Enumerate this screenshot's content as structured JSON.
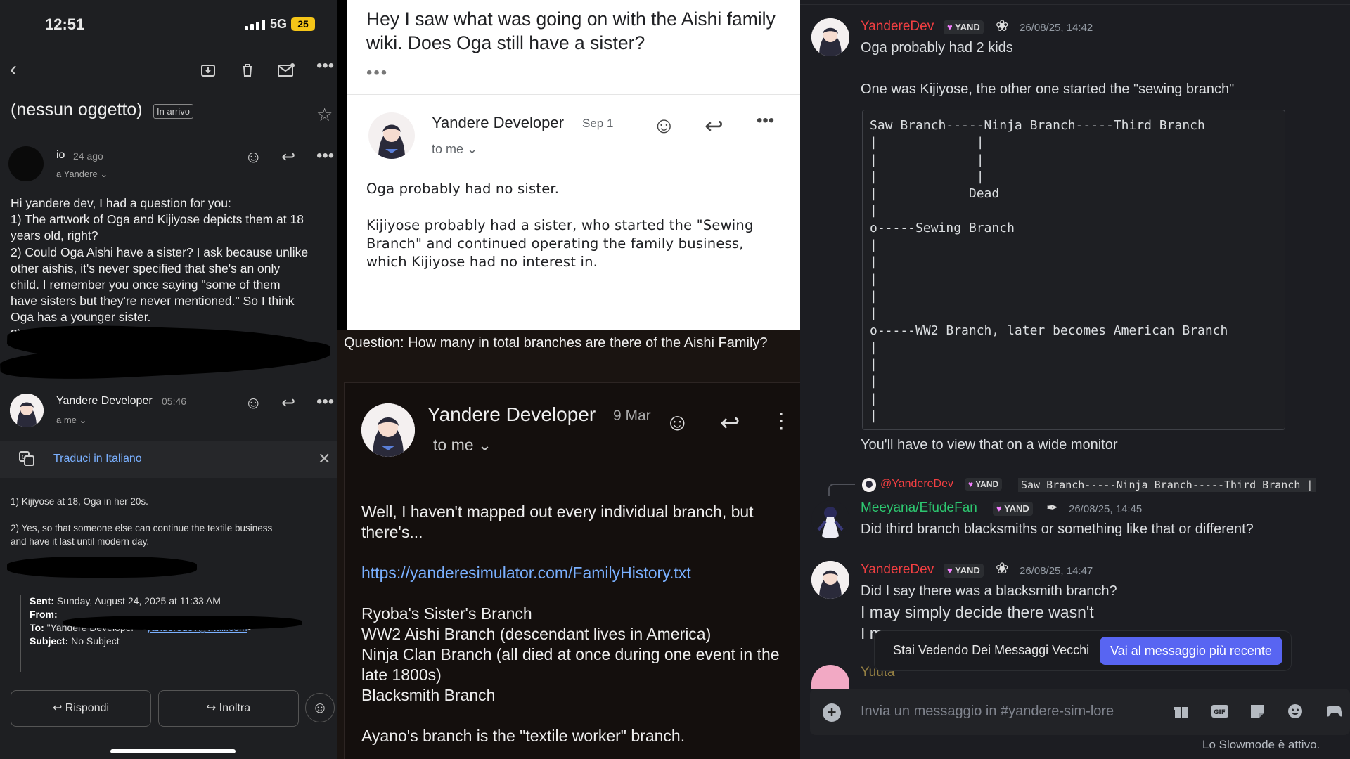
{
  "panel_a": {
    "status": {
      "time": "12:51",
      "network": "5G",
      "battery": "25"
    },
    "subject": "(nessun oggetto)",
    "folder_tag": "In arrivo",
    "msg1": {
      "from": "io",
      "date": "24 ago",
      "to": "a Yandere ⌄",
      "body": [
        "Hi yandere dev, I had a question for you:",
        "1) The artwork of Oga and Kijiyose depicts them at 18",
        "years old, right?",
        "2) Could Oga Aishi have a sister? I ask because unlike",
        "other aishis, it's never specified that she's an only",
        "child. I remember you once saying \"some of them",
        "have sisters but they're never mentioned.\" So I think",
        "Oga has a younger sister.",
        "3) C..."
      ]
    },
    "msg2": {
      "from": "Yandere Developer",
      "time": "05:46",
      "to": "a me ⌄"
    },
    "translate_label": "Traduci in Italiano",
    "reply_body": [
      "1) Kijiyose at 18, Oga in her 20s.",
      "",
      "2) Yes, so that someone else can continue the textile business",
      "and have it last until modern day."
    ],
    "quote": {
      "sent_label": "Sent:",
      "sent_value": "Sunday, August 24, 2025 at 11:33 AM",
      "from_label": "From:",
      "to_label": "To:",
      "to_value": "\"Yandere Developer\" <",
      "to_email": "yanderedev@mail.com",
      "to_end": ">",
      "subject_label": "Subject:",
      "subject_value": "No Subject"
    },
    "buttons": {
      "reply": "↩  Rispondi",
      "forward": "↪  Inoltra"
    }
  },
  "panel_b": {
    "question": "Hey I saw what was going on with the Aishi family wiki. Does Oga still have a sister?",
    "sender": "Yandere Developer",
    "date": "Sep 1",
    "to": "to me ⌄",
    "body": [
      "Oga probably had no sister.",
      "",
      "Kijiyose probably had a sister, who started the \"Sewing",
      "Branch\" and continued operating the family business,",
      "which Kijiyose had no interest in."
    ]
  },
  "panel_c": {
    "question": "Question: How many in total branches are there of the Aishi Family?",
    "sender": "Yandere Developer",
    "date": "9 Mar",
    "to": "to me ⌄",
    "body_intro": "Well, I haven't mapped out every individual branch, but there's...",
    "link": "https://yanderesimulator.com/FamilyHistory.txt",
    "branches": [
      "Ryoba's Sister's Branch",
      "WW2 Aishi Branch (descendant lives in America)",
      "Ninja Clan Branch (all died at once during one event in the late 1800s)",
      "Blacksmith Branch"
    ],
    "closing": "Ayano's branch is the \"textile worker\" branch."
  },
  "panel_d": {
    "msg1": {
      "name": "YandereDev",
      "badge": "YAND",
      "time": "26/08/25, 14:42",
      "lines": [
        "Oga probably had 2 kids",
        "One was Kijiyose, the other one started the \"sewing branch\""
      ],
      "code": "Saw Branch-----Ninja Branch-----Third Branch\n|             |\n|             |\n|             |\n|            Dead\n|\no-----Sewing Branch\n|\n|\n|\n|\n|\no-----WW2 Branch, later becomes American Branch\n|\n|\n|\n|\n|",
      "after": "You'll have to view that on a wide monitor"
    },
    "reply_ref": {
      "name": "@YandereDev",
      "badge": "YAND",
      "code": "Saw Branch-----Ninja Branch-----Third Branch |"
    },
    "msg2": {
      "name": "Meeyana/EfudeFan",
      "badge": "YAND",
      "time": "26/08/25, 14:45",
      "text": "Did third branch blacksmiths or something like that or different?"
    },
    "msg3": {
      "name": "YandereDev",
      "badge": "YAND",
      "time": "26/08/25, 14:47",
      "line1": "Did I say there was a blacksmith branch?",
      "line2": "I may simply decide there wasn't",
      "line3": "I m"
    },
    "next_name": "Yuuta",
    "toast": {
      "label": "Stai Vedendo Dei Messaggi Vecchi",
      "button": "Vai al messaggio più recente"
    },
    "input_placeholder": "Invia un messaggio in #yandere-sim-lore",
    "slowmode": "Lo Slowmode è attivo."
  },
  "colors": {
    "discord_red": "#f23f42",
    "discord_green": "#2dc770",
    "discord_blurple": "#5865f2",
    "link_blue": "#7ab0ff"
  }
}
